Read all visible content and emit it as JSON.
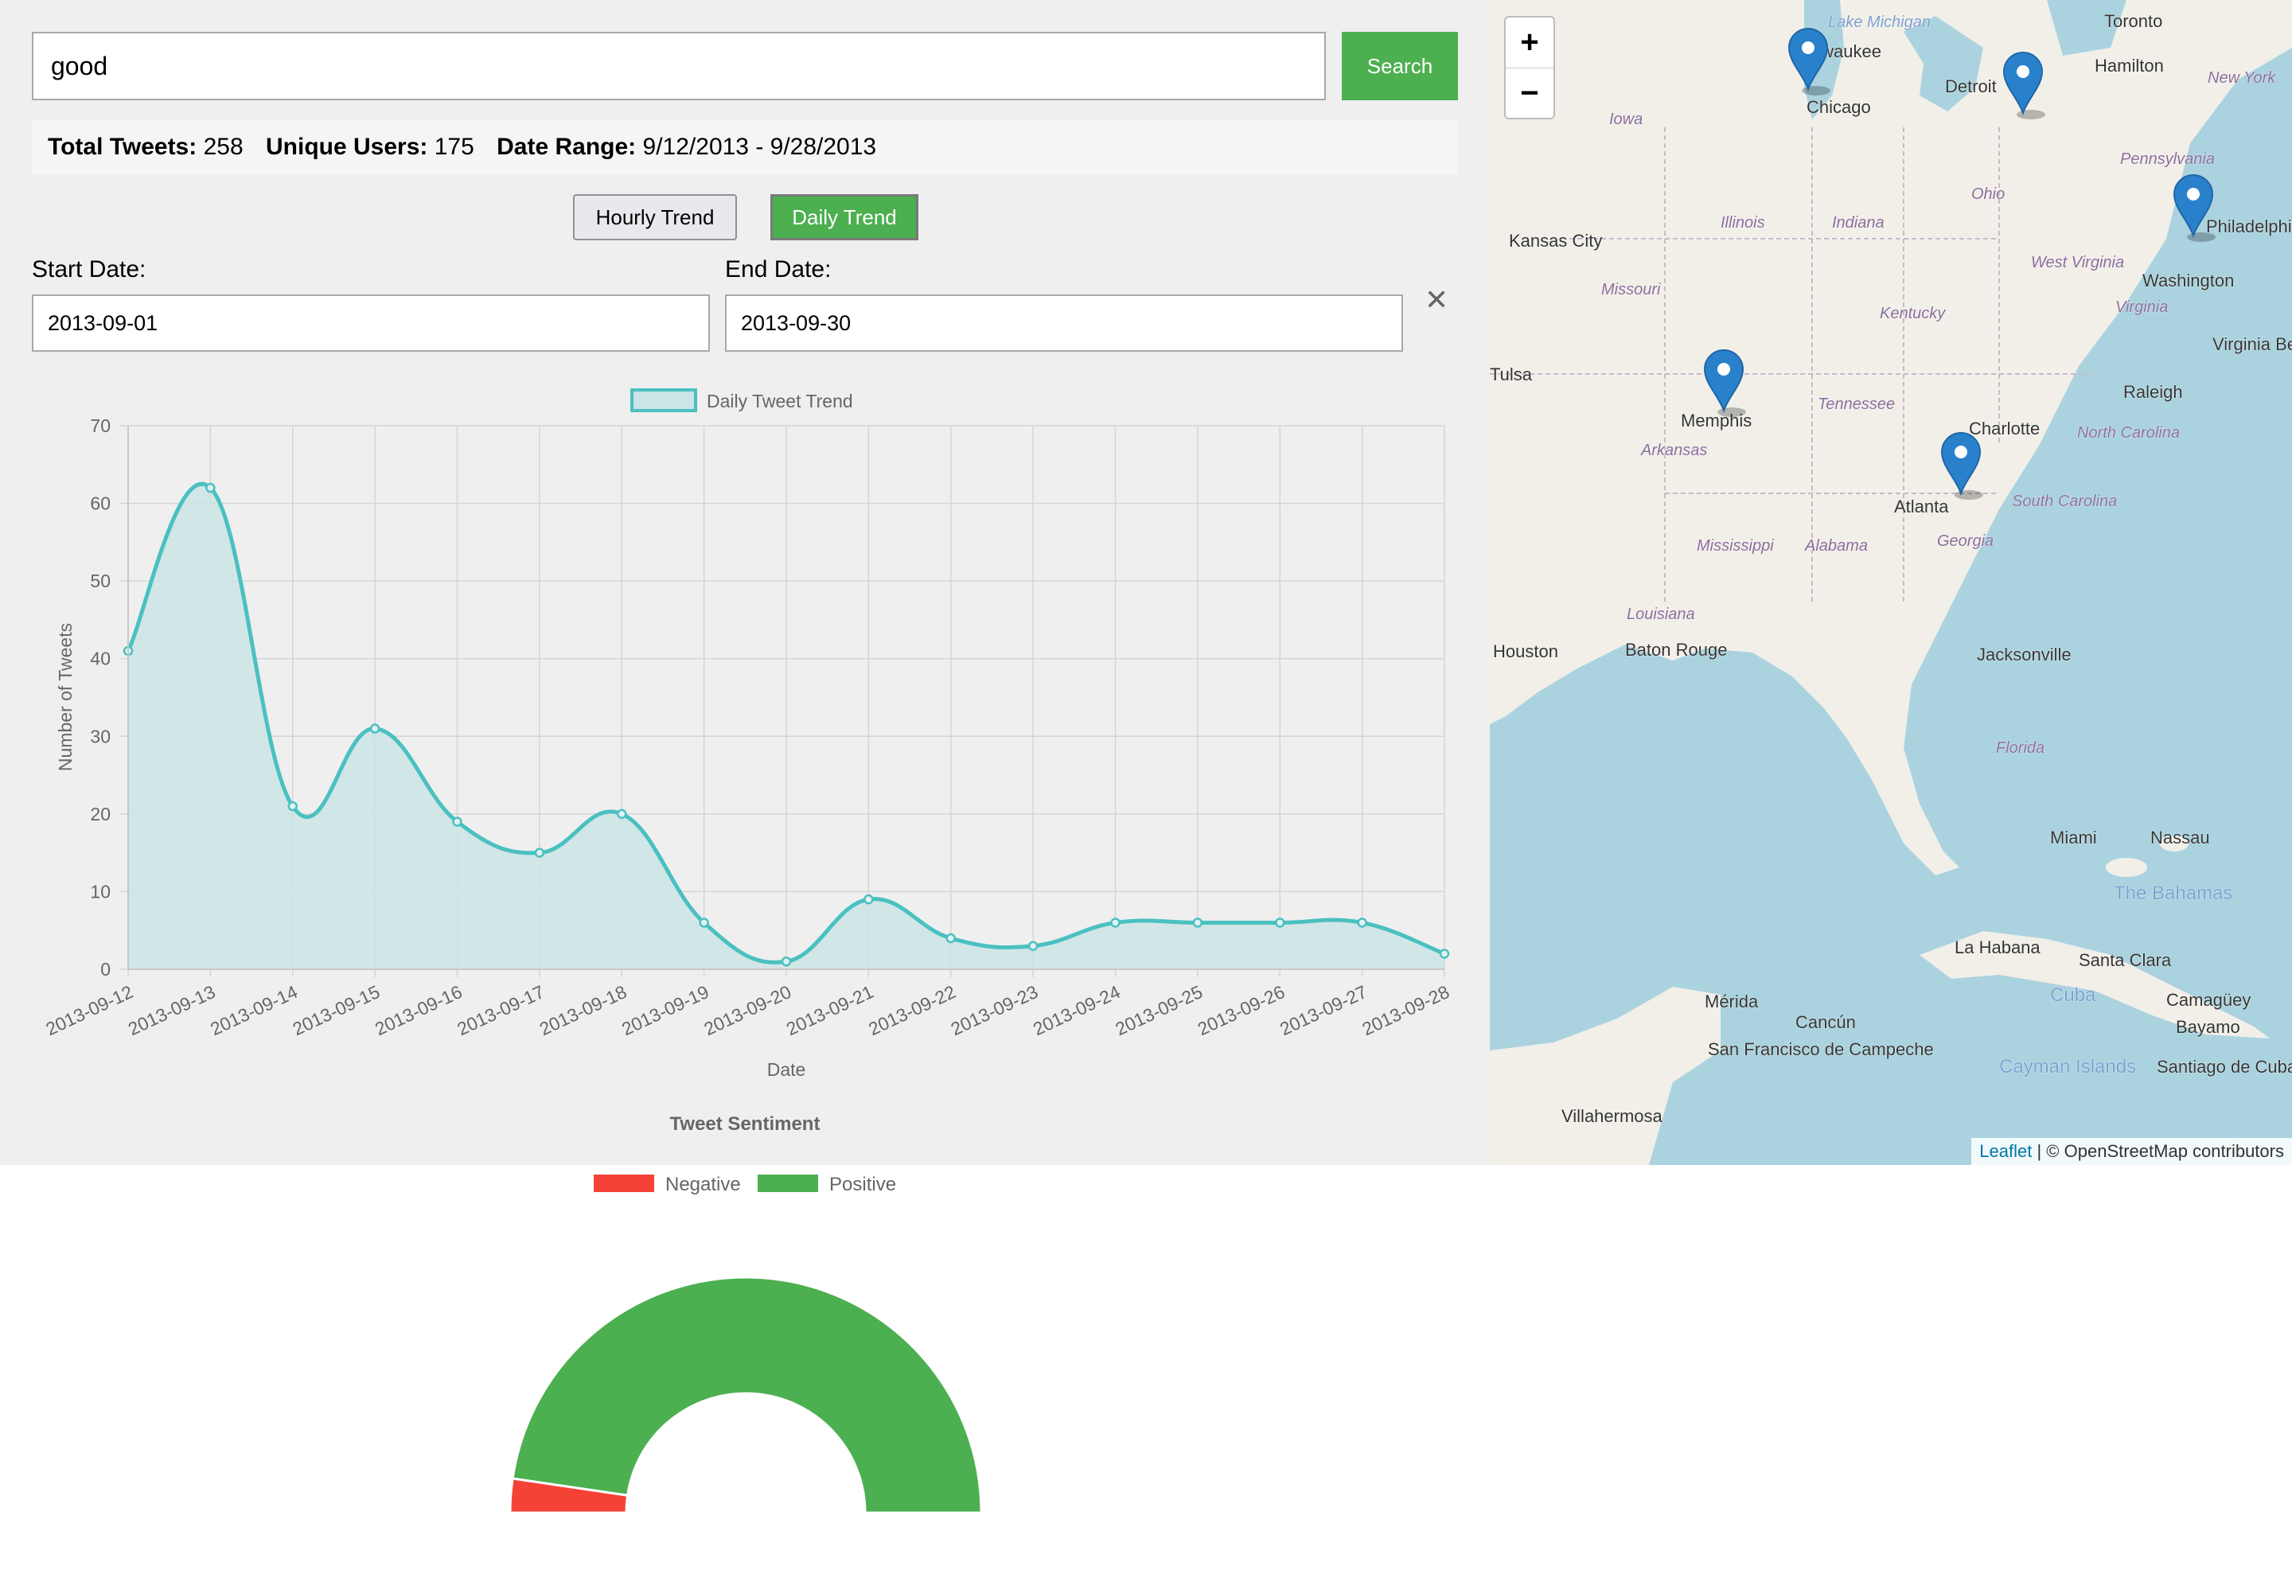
{
  "search": {
    "query": "good",
    "button_label": "Search"
  },
  "stats": {
    "total_tweets_label": "Total Tweets:",
    "total_tweets_value": "258",
    "unique_users_label": "Unique Users:",
    "unique_users_value": "175",
    "date_range_label": "Date Range:",
    "date_range_value": "9/12/2013 - 9/28/2013"
  },
  "trend_buttons": {
    "hourly": "Hourly Trend",
    "daily": "Daily Trend",
    "active": "daily"
  },
  "date_filter": {
    "start_label": "Start Date:",
    "start_value": "2013-09-01",
    "end_label": "End Date:",
    "end_value": "2013-09-30",
    "clear_icon": "close-icon",
    "clear_glyph": "✕"
  },
  "chart_data": [
    {
      "type": "area",
      "title": "",
      "series": [
        {
          "name": "Daily Tweet Trend",
          "values": [
            41,
            62,
            21,
            31,
            19,
            15,
            20,
            6,
            1,
            9,
            4,
            3,
            6,
            6,
            6,
            6,
            2
          ]
        }
      ],
      "x": [
        "2013-09-12",
        "2013-09-13",
        "2013-09-14",
        "2013-09-15",
        "2013-09-16",
        "2013-09-17",
        "2013-09-18",
        "2013-09-19",
        "2013-09-20",
        "2013-09-21",
        "2013-09-22",
        "2013-09-23",
        "2013-09-24",
        "2013-09-25",
        "2013-09-26",
        "2013-09-27",
        "2013-09-28"
      ],
      "xlabel": "Date",
      "ylabel": "Number of Tweets",
      "ylim": [
        0,
        70
      ],
      "yticks": [
        0,
        10,
        20,
        30,
        40,
        50,
        60,
        70
      ],
      "grid": true,
      "legend": "top",
      "colors": {
        "line": "#4bc0c0",
        "fill": "#cbe4e5"
      }
    },
    {
      "type": "pie",
      "style": "half-doughnut",
      "title": "Tweet Sentiment",
      "categories": [
        "Negative",
        "Positive"
      ],
      "values": [
        12,
        246
      ],
      "legend": "top",
      "colors": {
        "Negative": "#f44336",
        "Positive": "#4caf50"
      }
    }
  ],
  "map": {
    "zoom_in_label": "+",
    "zoom_out_label": "−",
    "attribution_link": "Leaflet",
    "attribution_rest": " | © OpenStreetMap contributors",
    "marker_icon": "map-marker-icon",
    "colors": {
      "water": "#aad3df",
      "land": "#f2efe9",
      "marker": "#2a81cb"
    },
    "places": [
      "Lake Michigan",
      "Milwaukee",
      "Chicago",
      "Detroit",
      "Toronto",
      "Hamilton",
      "New York",
      "Iowa",
      "Illinois",
      "Indiana",
      "Ohio",
      "Pennsylvania",
      "Kansas City",
      "Missouri",
      "Kentucky",
      "West Virginia",
      "Virginia",
      "Washington",
      "Philadelphia",
      "Virginia Beach",
      "Tulsa",
      "Tennessee",
      "Arkansas",
      "Memphis",
      "Raleigh",
      "North Carolina",
      "Charlotte",
      "Atlanta",
      "South Carolina",
      "Georgia",
      "Mississippi",
      "Alabama",
      "Louisiana",
      "Baton Rouge",
      "Houston",
      "Jacksonville",
      "Florida",
      "Miami",
      "Nassau",
      "The Bahamas",
      "La Habana",
      "Santa Clara",
      "Cuba",
      "Camagüey",
      "Bayamo",
      "Santiago de Cuba",
      "Cayman Islands",
      "Mérida",
      "Cancún",
      "San Francisco de Campeche",
      "Villahermosa"
    ]
  }
}
